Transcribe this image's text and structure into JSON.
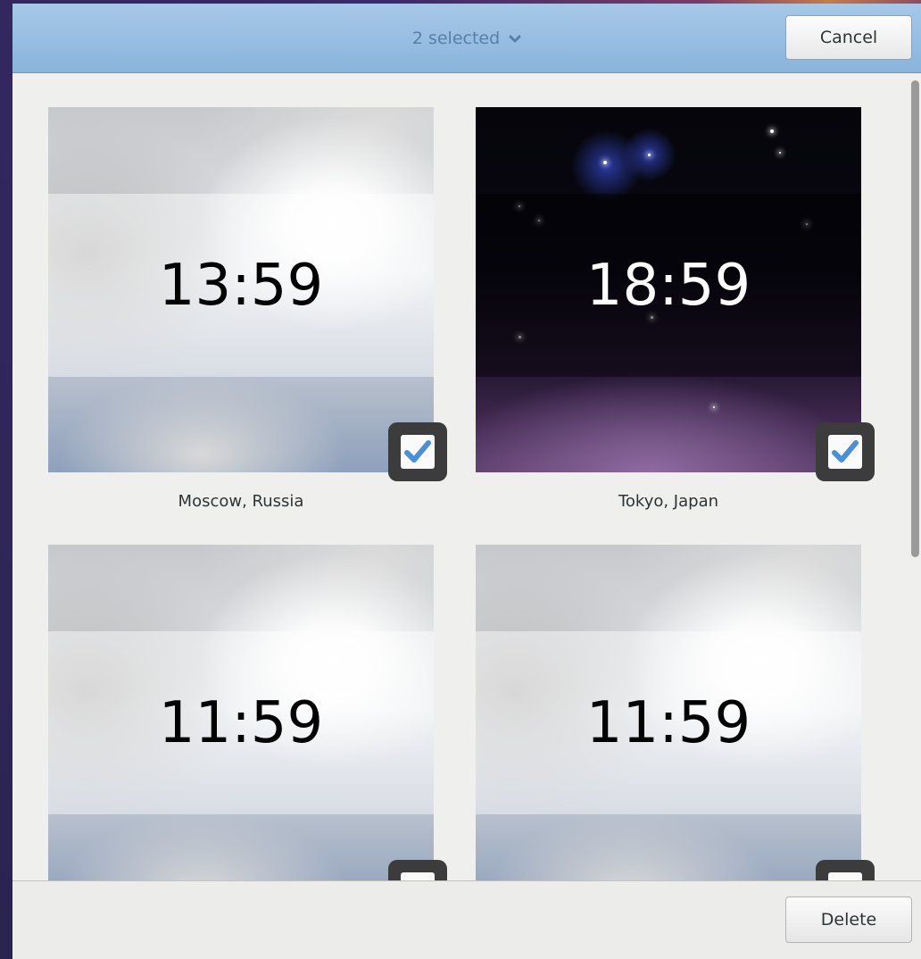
{
  "header": {
    "selection_label": "2 selected",
    "selection_icon": "chevron-down-icon",
    "cancel_label": "Cancel"
  },
  "clocks": [
    {
      "time": "13:59",
      "city": "Moscow, Russia",
      "selected": true,
      "theme": "day"
    },
    {
      "time": "18:59",
      "city": "Tokyo, Japan",
      "selected": true,
      "theme": "night"
    },
    {
      "time": "11:59",
      "city": "",
      "selected": false,
      "theme": "day"
    },
    {
      "time": "11:59",
      "city": "",
      "selected": false,
      "theme": "day"
    }
  ],
  "footer": {
    "delete_label": "Delete"
  },
  "colors": {
    "header_bg": "#8ab4dc",
    "check_blue": "#4a90d9",
    "window_bg": "#efefee"
  }
}
